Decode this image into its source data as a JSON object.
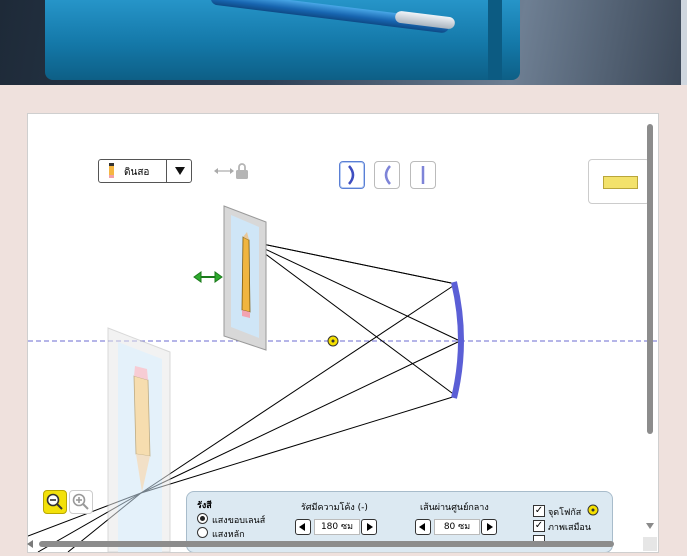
{
  "object_selector": {
    "selected": "ดินสอ"
  },
  "optic_types": [
    "concave-mirror",
    "convex-mirror",
    "plane-mirror"
  ],
  "control_panel": {
    "rays_title": "รังสี",
    "rays_options": [
      {
        "label": "แสงขอบเลนส์",
        "selected": true
      },
      {
        "label": "แสงหลัก",
        "selected": false
      }
    ],
    "radius": {
      "label": "รัศมีความโค้ง (-)",
      "value": "180 ซม"
    },
    "diameter": {
      "label": "เส้นผ่านศูนย์กลาง",
      "value": "80 ซม"
    },
    "checkboxes": [
      {
        "label": "จุดโฟกัส",
        "checked": true
      },
      {
        "label": "ภาพเสมือน",
        "checked": true
      }
    ]
  },
  "colors": {
    "mirror": "#5b5fd6",
    "axis": "#6b6bd0",
    "focal_point": "#f5e000",
    "move_arrow": "#2eaa2e"
  }
}
